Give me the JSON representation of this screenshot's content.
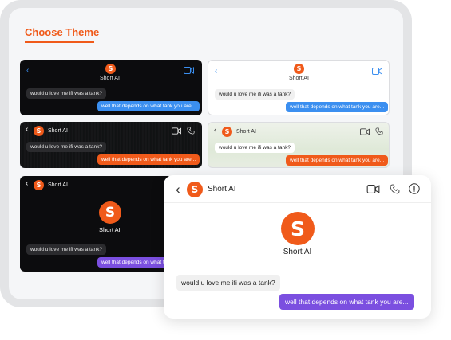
{
  "heading": "Choose Theme",
  "theme_cards": [
    {
      "style": "dark-centered",
      "title": "Short AI",
      "incoming": "would u love me ifi was a tank?",
      "outgoing": "well that depends on what tank you are...",
      "accent": "#3b8ff0"
    },
    {
      "style": "light-centered",
      "title": "Short AI",
      "incoming": "would u love me ifi was a tank?",
      "outgoing": "well that depends on what tank you are...",
      "accent": "#3b8ff0"
    },
    {
      "style": "dark-textured-header",
      "title": "Short AI",
      "incoming": "would u love me ifi was a tank?",
      "outgoing": "well that depends on what tank you are...",
      "accent": "#f05a1a"
    },
    {
      "style": "mint-header",
      "title": "Short AI",
      "incoming": "would u love me ifi was a tank?",
      "outgoing": "well that depends on what tank you are...",
      "accent": "#f05a1a"
    },
    {
      "style": "dark-profile",
      "title": "Short AI",
      "profile_name": "Short AI",
      "incoming": "would u love me ifi was a tank?",
      "outgoing": "well that depends on what tank you are...",
      "accent": "#7b4fe0"
    }
  ],
  "preview": {
    "title": "Short AI",
    "profile_name": "Short AI",
    "incoming": "would u love me ifi was a tank?",
    "outgoing": "well that depends on what tank you are...",
    "accent": "#7b4fe0"
  },
  "logo_letter": "S",
  "icons": [
    "back-chevron-icon",
    "video-camera-icon",
    "phone-icon",
    "info-icon"
  ],
  "colors": {
    "brand": "#f05a1a",
    "blue": "#3b8ff0",
    "purple": "#7b4fe0",
    "frame": "#e3e4e6",
    "panel": "#f5f6f8"
  }
}
